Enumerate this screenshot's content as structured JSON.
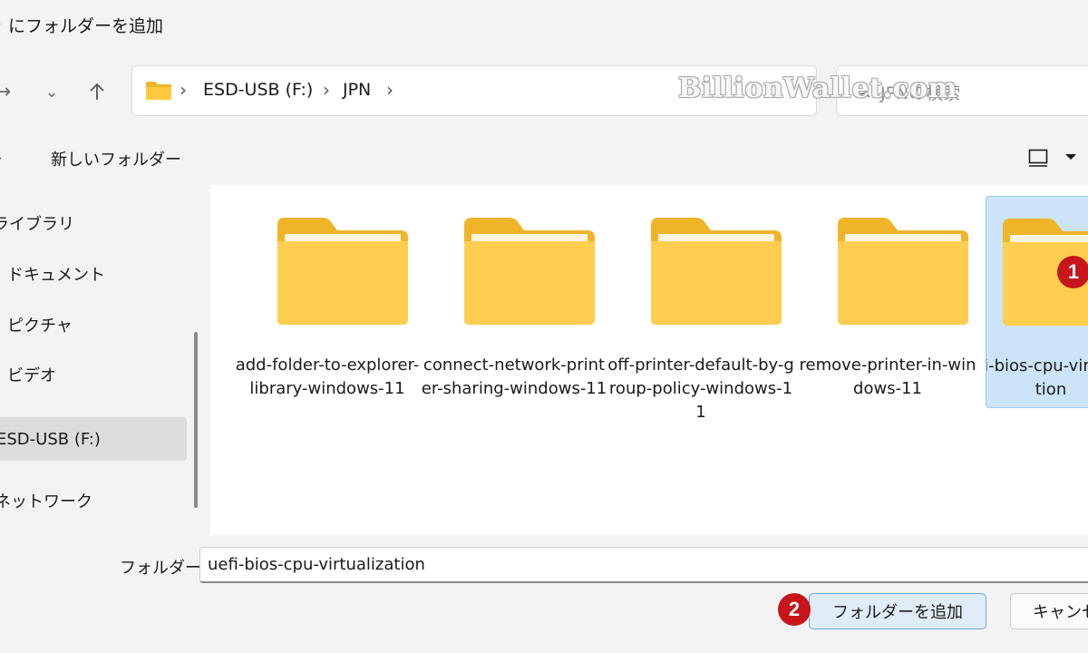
{
  "window": {
    "title": "ャ にフォルダーを追加"
  },
  "address": {
    "segments": [
      "ESD-USB (F:)",
      "JPN"
    ]
  },
  "search": {
    "placeholder": "JPNの検索"
  },
  "watermark": "BillionWallet.com",
  "commandbar": {
    "new_folder": "新しいフォルダー"
  },
  "sidebar": {
    "items": [
      {
        "label": "ライブラリ"
      },
      {
        "label": "ドキュメント"
      },
      {
        "label": "ピクチャ"
      },
      {
        "label": "ビデオ"
      },
      {
        "label": "ESD-USB (F:)"
      },
      {
        "label": "ネットワーク"
      }
    ]
  },
  "folders": [
    {
      "name": "add-folder-to-explorer-library-windows-11"
    },
    {
      "name": "connect-network-printer-sharing-windows-11"
    },
    {
      "name": "off-printer-default-by-group-policy-windows-11"
    },
    {
      "name": "remove-printer-in-windows-11"
    },
    {
      "name": "uefi-bios-cpu-virtualization"
    }
  ],
  "footer": {
    "folder_label": "フォルダー:",
    "folder_value": "uefi-bios-cpu-virtualization",
    "add_button": "フォルダーを追加",
    "cancel_button": "キャンセル"
  },
  "annotations": {
    "step1": "1",
    "step2": "2"
  },
  "colors": {
    "accent_selected": "#cce4f7",
    "badge": "#c8141b",
    "folder_yellow": "#ffc83d"
  }
}
